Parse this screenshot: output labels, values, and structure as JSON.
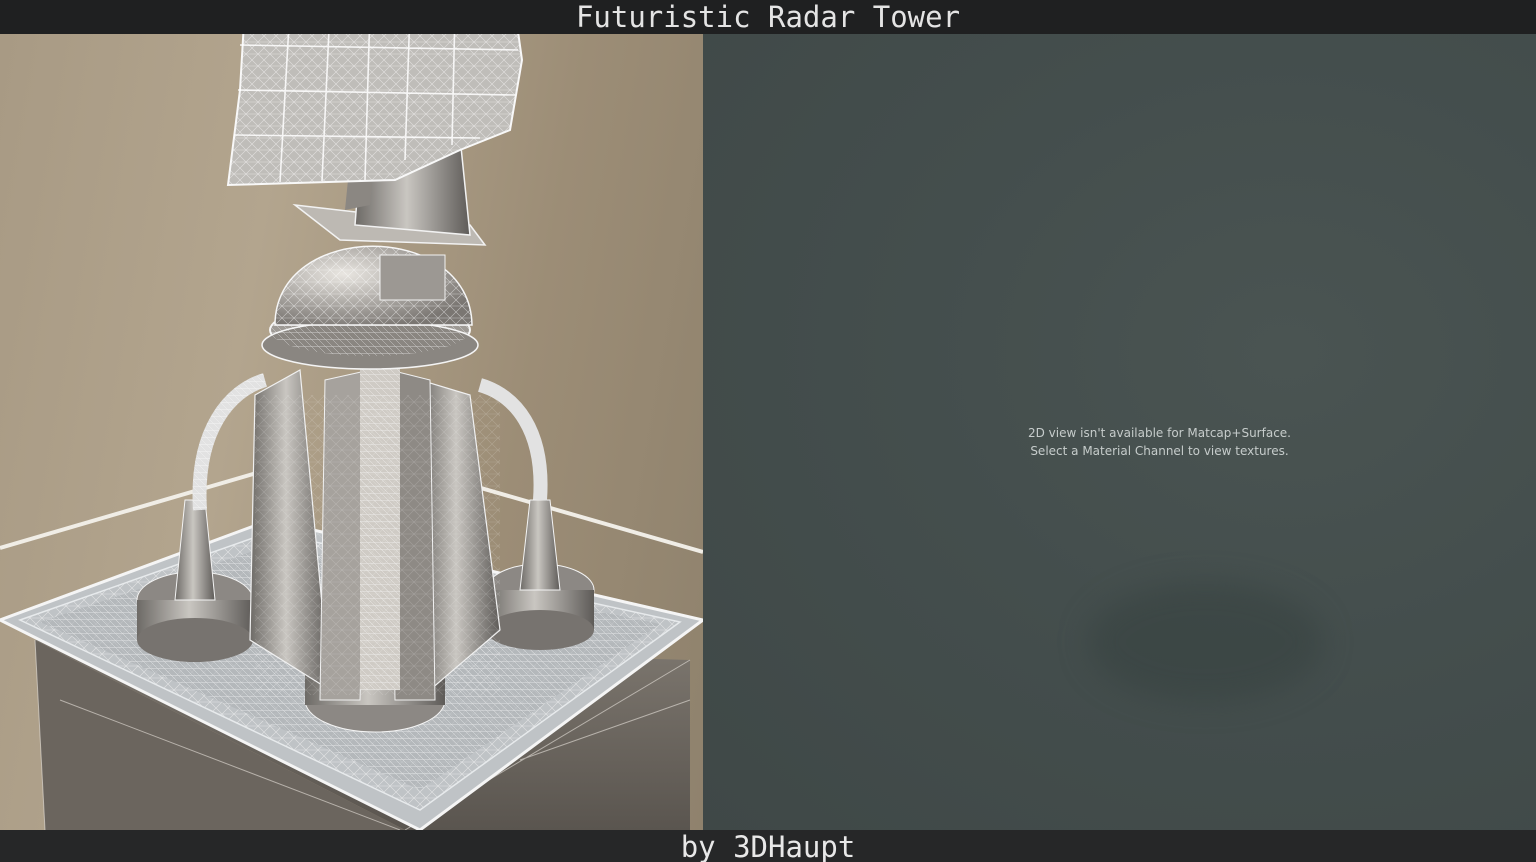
{
  "title": "Futuristic Radar Tower",
  "credit": "by 3DHaupt",
  "viewport_2d": {
    "notice_line1": "2D view isn't available for Matcap+Surface.",
    "notice_line2": "Select a Material Channel to view textures."
  },
  "colors": {
    "title_bar_bg": "#1f2021",
    "viewport_3d_bg": "#a89a84",
    "viewport_2d_bg": "#444e4d",
    "text_light": "#e4e4e4"
  }
}
